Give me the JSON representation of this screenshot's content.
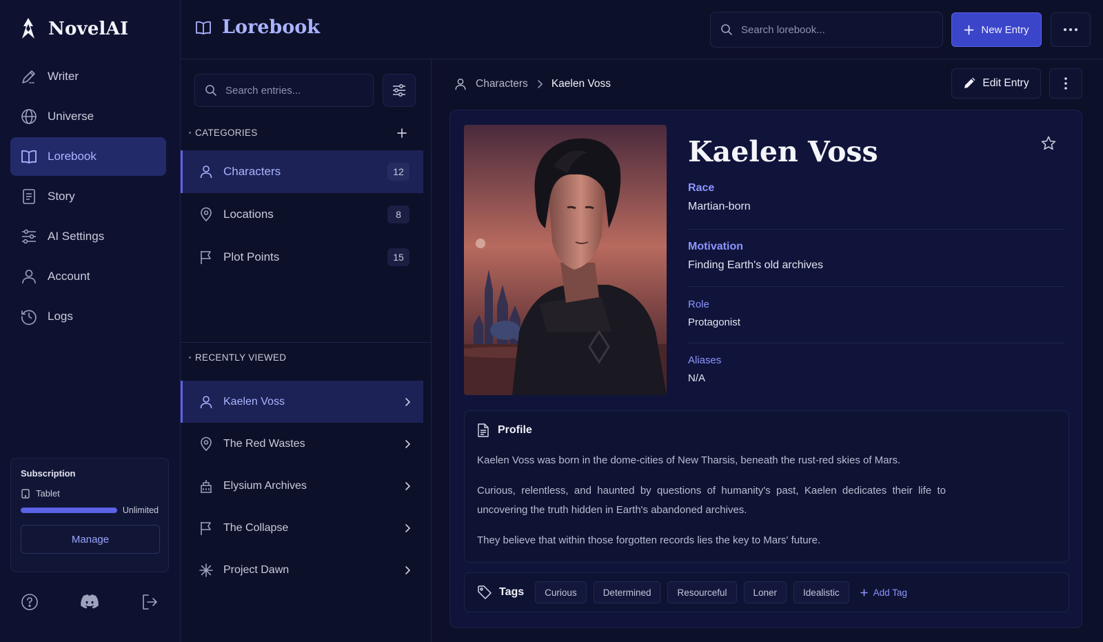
{
  "app": {
    "name": "NovelAI"
  },
  "nav": {
    "items": [
      {
        "label": "Writer",
        "icon": "pen-icon"
      },
      {
        "label": "Universe",
        "icon": "globe-icon"
      },
      {
        "label": "Lorebook",
        "icon": "book-icon",
        "active": true
      },
      {
        "label": "Story",
        "icon": "document-icon"
      },
      {
        "label": "AI Settings",
        "icon": "sliders-icon"
      },
      {
        "label": "Account",
        "icon": "user-icon"
      },
      {
        "label": "Logs",
        "icon": "history-icon"
      }
    ]
  },
  "subscription": {
    "title": "Subscription",
    "plan": "Tablet",
    "usage_label": "Unlimited",
    "usage_fraction": 1.0,
    "manage_label": "Manage"
  },
  "header": {
    "title": "Lorebook",
    "search_placeholder": "Search lorebook...",
    "new_entry_label": "New Entry"
  },
  "entries_panel": {
    "search_placeholder": "Search entries...",
    "categories_heading": "CATEGORIES",
    "categories": [
      {
        "label": "Characters",
        "count": "12",
        "icon": "user-icon",
        "active": true
      },
      {
        "label": "Locations",
        "count": "8",
        "icon": "pin-icon"
      },
      {
        "label": "Plot Points",
        "count": "15",
        "icon": "flag-icon"
      }
    ],
    "recent_heading": "RECENTLY VIEWED",
    "recent": [
      {
        "label": "Kaelen Voss",
        "icon": "user-icon",
        "active": true
      },
      {
        "label": "The Red Wastes",
        "icon": "pin-icon"
      },
      {
        "label": "Elysium Archives",
        "icon": "building-icon"
      },
      {
        "label": "The Collapse",
        "icon": "flag-icon"
      },
      {
        "label": "Project Dawn",
        "icon": "sparkle-icon"
      }
    ]
  },
  "entry": {
    "breadcrumb": {
      "parent": "Characters",
      "current": "Kaelen Voss"
    },
    "edit_label": "Edit Entry",
    "name": "Kaelen Voss",
    "attributes": [
      {
        "label": "Race",
        "value": "Martian-born"
      },
      {
        "label": "Motivation",
        "value": "Finding Earth's old archives"
      },
      {
        "label": "Role",
        "value": "Protagonist"
      },
      {
        "label": "Aliases",
        "value": "N/A"
      }
    ],
    "profile": {
      "heading": "Profile",
      "paragraphs": [
        "Kaelen Voss was born in the dome-cities of New Tharsis, beneath the rust-red skies of Mars.",
        "Curious, relentless, and haunted by questions of humanity's past, Kaelen dedicates their life to uncovering the truth hidden in Earth's abandoned archives.",
        "They believe that within those forgotten records lies the key to Mars' future."
      ]
    },
    "tags": {
      "heading": "Tags",
      "items": [
        "Curious",
        "Determined",
        "Resourceful",
        "Loner",
        "Idealistic"
      ],
      "add_label": "Add Tag"
    }
  },
  "colors": {
    "background": "#0d1029",
    "accent": "#5b63e6",
    "accent_text": "#aab3ff",
    "primary_button": "#3b45c9"
  }
}
